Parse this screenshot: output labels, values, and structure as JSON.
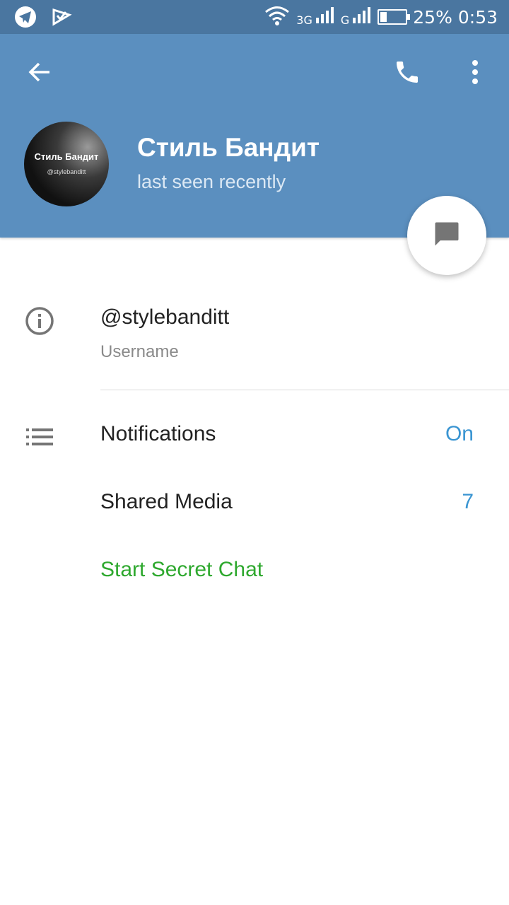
{
  "status_bar": {
    "network_3g": "3G",
    "network_g": "G",
    "battery": "25%",
    "battery_level": 0.25,
    "time": "0:53",
    "icons": [
      "telegram-icon",
      "check-notification-icon",
      "wifi-icon",
      "signal-3g-icon",
      "signal-g-icon",
      "battery-icon"
    ]
  },
  "header": {
    "back_icon": "back-arrow-icon",
    "call_icon": "phone-icon",
    "more_icon": "more-vert-icon",
    "avatar": {
      "line1": "Стиль Бандит",
      "line2": "@stylebanditt"
    },
    "name": "Стиль Бандит",
    "status": "last seen recently",
    "fab_icon": "message-icon"
  },
  "info": {
    "icon": "info-icon",
    "username": "@stylebanditt",
    "username_label": "Username"
  },
  "menu": {
    "notifications": {
      "icon": "list-icon",
      "label": "Notifications",
      "value": "On"
    },
    "shared_media": {
      "label": "Shared Media",
      "value": "7"
    },
    "secret_chat": {
      "label": "Start Secret Chat"
    }
  },
  "colors": {
    "status_bar": "#4a76a0",
    "header": "#5b8fbf",
    "accent_blue": "#3a95d2",
    "secret_green": "#2ea82e"
  }
}
